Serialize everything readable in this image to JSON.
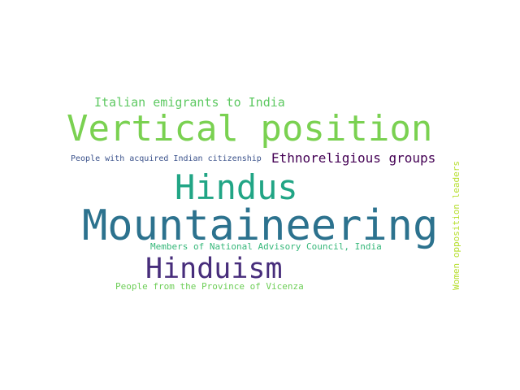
{
  "wordcloud": {
    "background": "#ffffff",
    "words": [
      {
        "id": "italian_emigrants",
        "text": "Italian emigrants to India",
        "color": "#5ec962"
      },
      {
        "id": "vertical_position",
        "text": "Vertical position",
        "color": "#7ad151"
      },
      {
        "id": "people_indian_citizenship",
        "text": "People with acquired Indian citizenship",
        "color": "#3b528b"
      },
      {
        "id": "ethnoreligious_groups",
        "text": "Ethnoreligious groups",
        "color": "#440154"
      },
      {
        "id": "hindus",
        "text": "Hindus",
        "color": "#21a585"
      },
      {
        "id": "mountaineering",
        "text": "Mountaineering",
        "color": "#2c728e"
      },
      {
        "id": "members_nac",
        "text": "Members of National Advisory Council, India",
        "color": "#35b779"
      },
      {
        "id": "hinduism",
        "text": "Hinduism",
        "color": "#472d7b"
      },
      {
        "id": "province_vicenza",
        "text": "People from the Province of Vicenza",
        "color": "#6ece58"
      },
      {
        "id": "women_opposition_leaders",
        "text": "Women opposition leaders",
        "color": "#b5de2b"
      }
    ]
  }
}
